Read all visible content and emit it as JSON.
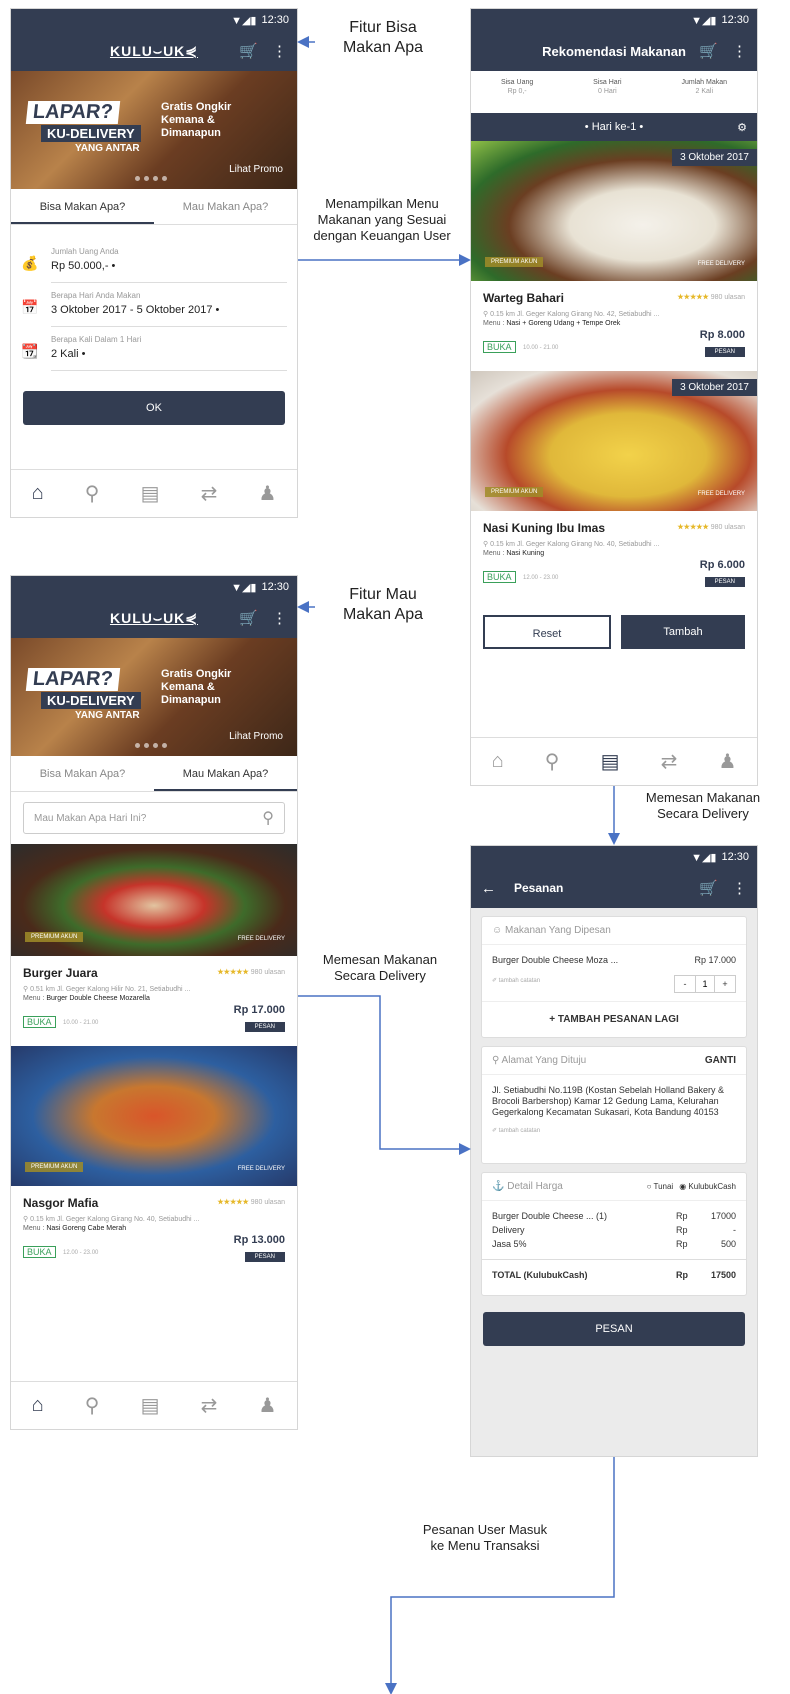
{
  "status": {
    "time": "12:30",
    "icons": "▼◢▮"
  },
  "app": {
    "logo": "KULU⌣UK⋞",
    "cart_icon": "cart-icon",
    "menu_icon": "more-vert-icon"
  },
  "banner": {
    "lapar": "LAPAR?",
    "kudelivery": "KU-DELIVERY",
    "yang_antar": "YANG ANTAR",
    "gratis": "Gratis Ongkir Kemana & Dimanapun",
    "lihat_promo": "Lihat Promo"
  },
  "tabs": [
    "Bisa Makan Apa?",
    "Mau Makan Apa?"
  ],
  "screen1": {
    "fields": [
      {
        "label": "Jumlah Uang Anda",
        "value": "Rp 50.000,- •"
      },
      {
        "label": "Berapa Hari Anda Makan",
        "value": "3 Oktober 2017 - 5 Oktober 2017 •"
      },
      {
        "label": "Berapa Kali Dalam 1 Hari",
        "value": "2 Kali •"
      }
    ],
    "ok": "OK"
  },
  "screen2": {
    "title": "Rekomendasi Makanan",
    "summary": [
      {
        "label": "Sisa Uang",
        "value": "Rp 0,-"
      },
      {
        "label": "Sisa Hari",
        "value": "0 Hari"
      },
      {
        "label": "Jumlah Makan",
        "value": "2 Kali"
      }
    ],
    "day": "• Hari ke-1 •",
    "cards": [
      {
        "date": "3 Oktober 2017",
        "premium": "PREMIUM AKUN",
        "free": "FREE DELIVERY",
        "name": "Warteg Bahari",
        "stars": "★★★★★",
        "reviews": "980 ulasan",
        "address": "⚲ 0.15 km   Jl. Geger Kalong Girang No. 42, Setiabudhi ...",
        "menu_label": "Menu : ",
        "menu": "Nasi + Goreng Udang + Tempe Orek",
        "buka": "BUKA",
        "hours": "10.00 - 21.00",
        "price": "Rp 8.000",
        "pesan": "PESAN"
      },
      {
        "date": "3 Oktober 2017",
        "premium": "PREMIUM AKUN",
        "free": "FREE DELIVERY",
        "name": "Nasi Kuning Ibu Imas",
        "stars": "★★★★★",
        "reviews": "980 ulasan",
        "address": "⚲ 0.15 km   Jl. Geger Kalong Girang No. 40, Setiabudhi ...",
        "menu_label": "Menu : ",
        "menu": "Nasi Kuning",
        "buka": "BUKA",
        "hours": "12.00 - 23.00",
        "price": "Rp 6.000",
        "pesan": "PESAN"
      }
    ],
    "reset": "Reset",
    "tambah": "Tambah"
  },
  "screen3": {
    "search_placeholder": "Mau Makan Apa Hari Ini?",
    "cards": [
      {
        "premium": "PREMIUM AKUN",
        "free": "FREE DELIVERY",
        "name": "Burger Juara",
        "stars": "★★★★★",
        "reviews": "980 ulasan",
        "address": "⚲ 0.51 km   Jl. Geger Kalong Hilir No. 21, Setiabudhi ...",
        "menu_label": "Menu : ",
        "menu": "Burger Double Cheese Mozarella",
        "buka": "BUKA",
        "hours": "10.00 - 21.00",
        "price": "Rp 17.000",
        "pesan": "PESAN"
      },
      {
        "premium": "PREMIUM AKUN",
        "free": "FREE DELIVERY",
        "name": "Nasgor Mafia",
        "stars": "★★★★★",
        "reviews": "980 ulasan",
        "address": "⚲ 0.15 km   Jl. Geger Kalong Girang No. 40, Setiabudhi ...",
        "menu_label": "Menu : ",
        "menu": "Nasi Goreng Cabe Merah",
        "buka": "BUKA",
        "hours": "12.00 - 23.00",
        "price": "Rp 13.000",
        "pesan": "PESAN"
      }
    ]
  },
  "screen4": {
    "title": "Pesanan",
    "ordered_header": "☺  Makanan Yang Dipesan",
    "item": "Burger Double Cheese Moza ...",
    "item_price": "Rp 17.000",
    "note": "✐ tambah catatan",
    "qty_minus": "-",
    "qty": "1",
    "qty_plus": "+",
    "add_more": "+ TAMBAH PESANAN LAGI",
    "address_header": "⚲  Alamat Yang Dituju",
    "ganti": "GANTI",
    "address": "Jl. Setiabudhi No.119B (Kostan Sebelah Holland Bakery & Brocoli Barbershop) Kamar 12 Gedung Lama, Kelurahan Gegerkalong Kecamatan Sukasari, Kota Bandung 40153",
    "price_header": "⚓  Detail Harga",
    "tunai": "Tunai",
    "kulubukcash": "KulubukCash",
    "rows": [
      {
        "label": "Burger Double Cheese ... (1)",
        "cur": "Rp",
        "amt": "17000"
      },
      {
        "label": "Delivery",
        "cur": "Rp",
        "amt": "-"
      },
      {
        "label": "Jasa 5%",
        "cur": "Rp",
        "amt": "500"
      }
    ],
    "total_label": "TOTAL (KulubukCash)",
    "total_cur": "Rp",
    "total_amt": "17500",
    "pesan": "PESAN"
  },
  "annotations": {
    "fitur_bisa": "Fitur Bisa\nMakan Apa",
    "menampilkan": "Menampilkan Menu\nMakanan yang Sesuai\ndengan Keuangan User",
    "fitur_mau": "Fitur Mau\nMakan Apa",
    "memesan1": "Memesan Makanan\nSecara Delivery",
    "memesan2": "Memesan Makanan\nSecara Delivery",
    "transaksi": "Pesanan User Masuk\nke Menu Transaksi"
  },
  "colors": {
    "primary": "#333d52",
    "arrow": "#4a72c4",
    "star": "#e6b82a",
    "open": "#3aa05a"
  }
}
